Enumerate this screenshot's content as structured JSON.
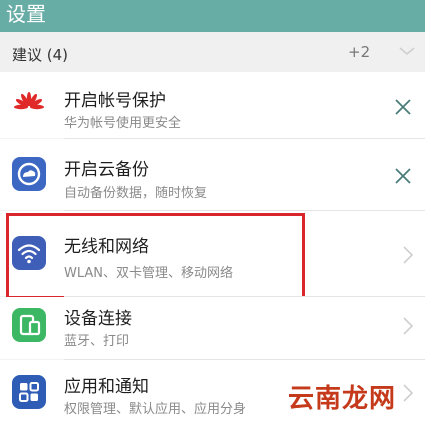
{
  "header": {
    "title": "设置"
  },
  "suggestions": {
    "label": "建议 (4)",
    "more_count": "+2",
    "expand_icon": "chevron-down-icon"
  },
  "items": [
    {
      "title": "开启帐号保护",
      "subtitle": "华为帐号使用更安全",
      "icon": "huawei-logo-icon",
      "action": "close"
    },
    {
      "title": "开启云备份",
      "subtitle": "自动备份数据，随时恢复",
      "icon": "cloud-backup-icon",
      "action": "close"
    },
    {
      "title": "无线和网络",
      "subtitle": "WLAN、双卡管理、移动网络",
      "icon": "wifi-icon",
      "action": "navigate",
      "highlighted": true
    },
    {
      "title": "设备连接",
      "subtitle": "蓝牙、打印",
      "icon": "device-connection-icon",
      "action": "navigate"
    },
    {
      "title": "应用和通知",
      "subtitle": "权限管理、默认应用、应用分身",
      "icon": "apps-icon",
      "action": "navigate"
    }
  ],
  "watermark": "云南龙网",
  "colors": {
    "header_bg": "#67aca5",
    "highlight": "#d9262c",
    "wifi_icon": "#3e5eb8",
    "device_icon": "#3cb864",
    "apps_icon": "#2f5db5"
  }
}
